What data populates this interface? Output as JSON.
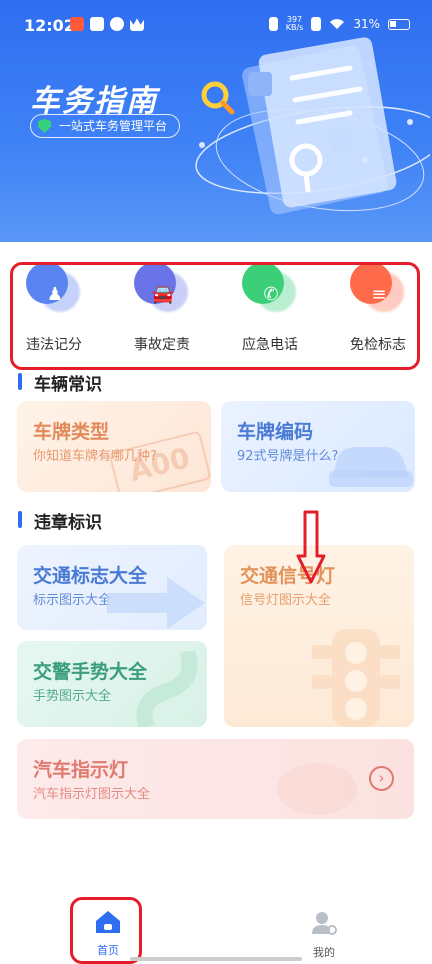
{
  "status": {
    "time": "12:02",
    "net_speed": "397",
    "net_unit": "KB/s",
    "battery": "31%"
  },
  "hero": {
    "title": "车务指南",
    "subtitle": "一站式车务管理平台"
  },
  "quick_actions": [
    {
      "label": "违法记分",
      "icon": "violation-points-icon",
      "color": "#5b84f3"
    },
    {
      "label": "事故定责",
      "icon": "accident-car-icon",
      "color": "#6a73e8"
    },
    {
      "label": "应急电话",
      "icon": "phone-icon",
      "color": "#3ccf7a"
    },
    {
      "label": "免检标志",
      "icon": "exempt-sign-icon",
      "color": "#ff6a4a"
    }
  ],
  "sections": {
    "vehicle": {
      "title": "车辆常识"
    },
    "violation": {
      "title": "违章标识"
    }
  },
  "cards": {
    "plate_type": {
      "title": "车牌类型",
      "subtitle": "你知道车牌有哪几种?",
      "deco": "A00"
    },
    "plate_code": {
      "title": "车牌编码",
      "subtitle": "92式号牌是什么?"
    },
    "traffic_sign": {
      "title": "交通标志大全",
      "subtitle": "标示图示大全"
    },
    "traffic_light": {
      "title": "交通信号灯",
      "subtitle": "信号灯图示大全"
    },
    "police_gesture": {
      "title": "交警手势大全",
      "subtitle": "手势图示大全"
    },
    "indicator": {
      "title": "汽车指示灯",
      "subtitle": "汽车指示灯图示大全",
      "go": "›"
    }
  },
  "nav": {
    "home": "首页",
    "mine": "我的"
  },
  "colors": {
    "primary": "#2f6ef0",
    "annotation": "#e51d2a"
  }
}
